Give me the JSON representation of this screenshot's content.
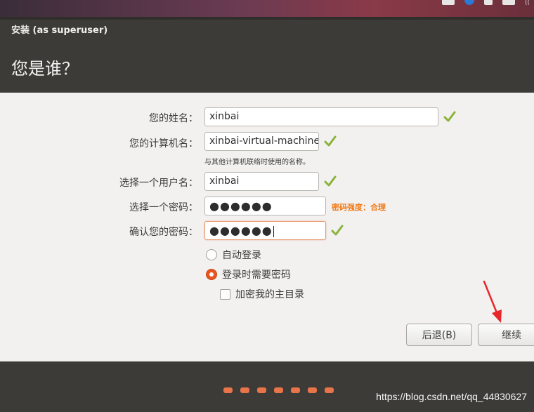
{
  "window": {
    "title": "安装 (as superuser)"
  },
  "page": {
    "heading": "您是谁？"
  },
  "form": {
    "name_label": "您的姓名：",
    "name_value": "xinbai",
    "computer_label": "您的计算机名：",
    "computer_value": "xinbai-virtual-machine",
    "computer_hint": "与其他计算机联络时使用的名称。",
    "username_label": "选择一个用户名：",
    "username_value": "xinbai",
    "password_label": "选择一个密码：",
    "password_value": "●●●●●●",
    "password_strength": "密码强度：合理",
    "confirm_label": "确认您的密码：",
    "confirm_value": "●●●●●●"
  },
  "options": {
    "auto_login": "自动登录",
    "require_password": "登录时需要密码",
    "encrypt_home": "加密我的主目录",
    "selected": "require_password",
    "encrypt_checked": false
  },
  "buttons": {
    "back": "后退(B)",
    "continue": "继续"
  },
  "progress": {
    "total_steps": 7
  },
  "watermark": "https://blog.csdn.net/qq_44830627",
  "colors": {
    "accent": "#e95420",
    "check": "#8bb33a",
    "strength": "#f07a17",
    "title_bg": "#3c3b37"
  },
  "icons": [
    "check-icon",
    "radio-icon",
    "checkbox-icon",
    "red-arrow-annotation"
  ]
}
